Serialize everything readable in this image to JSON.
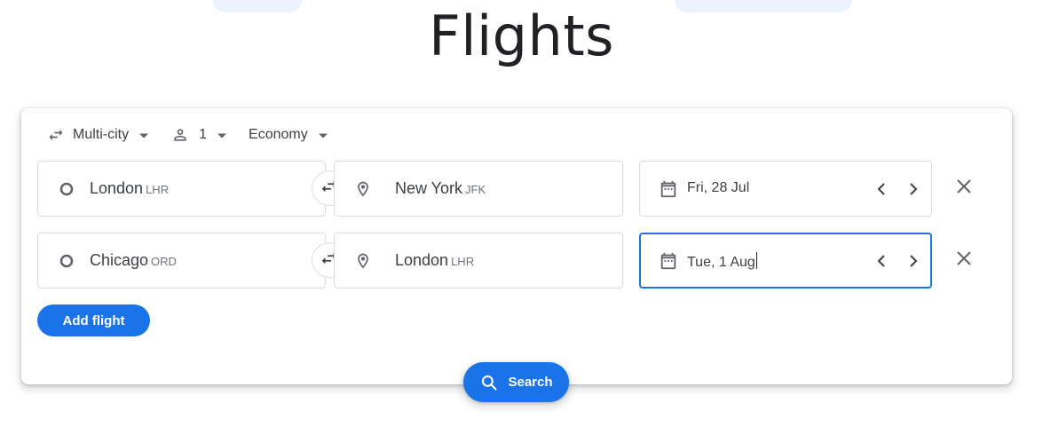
{
  "page": {
    "title": "Flights"
  },
  "colors": {
    "primary": "#1a73e8",
    "text": "#3c4043",
    "muted": "#70757a",
    "border": "#dadce0"
  },
  "search_options": {
    "trip_type": "Multi-city",
    "passengers": "1",
    "cabin_class": "Economy"
  },
  "legs": [
    {
      "origin_city": "London",
      "origin_code": "LHR",
      "destination_city": "New York",
      "destination_code": "JFK",
      "date": "Fri, 28 Jul"
    },
    {
      "origin_city": "Chicago",
      "origin_code": "ORD",
      "destination_city": "London",
      "destination_code": "LHR",
      "date": "Tue, 1 Aug"
    }
  ],
  "actions": {
    "add_flight_label": "Add flight",
    "search_label": "Search"
  },
  "icons": {
    "trip_type": "swap-arrows-icon",
    "passengers": "person-icon",
    "origin": "circle-icon",
    "destination": "location-pin-icon",
    "date": "calendar-icon",
    "swap": "swap-horizontal-icon",
    "prev": "chevron-left-icon",
    "next": "chevron-right-icon",
    "remove": "close-icon",
    "search": "search-icon",
    "dropdown": "caret-down-icon"
  }
}
